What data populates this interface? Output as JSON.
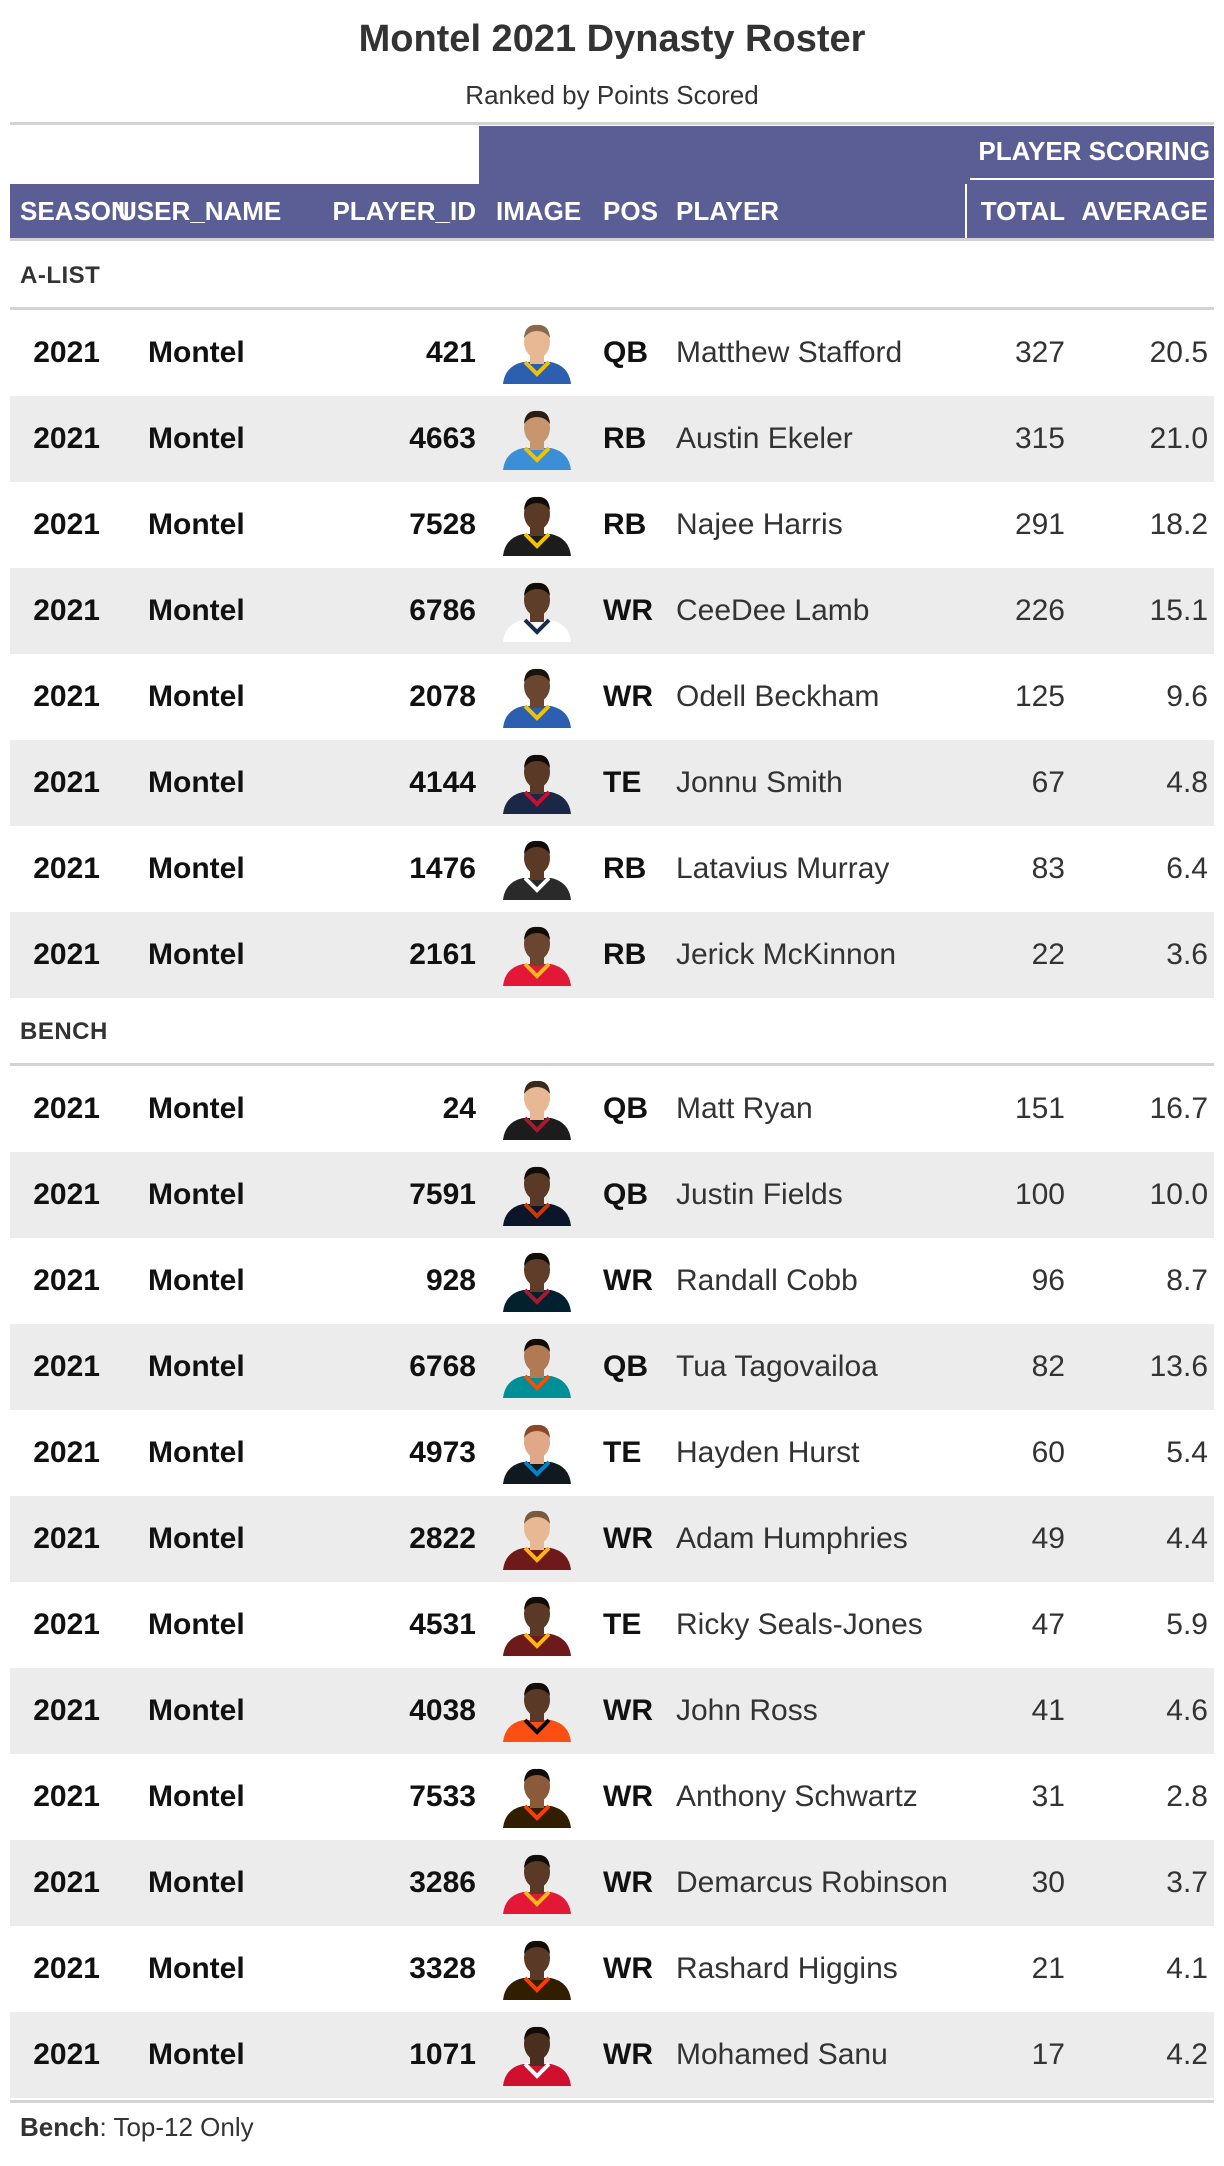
{
  "title": "Montel 2021 Dynasty Roster",
  "subtitle": "Ranked by Points Scored",
  "spanner": "PLAYER SCORING",
  "columns": {
    "season": "SEASON",
    "user_name": "USER_NAME",
    "player_id": "PLAYER_ID",
    "image": "IMAGE",
    "pos": "POS",
    "player": "PLAYER",
    "total": "TOTAL",
    "average": "AVERAGE"
  },
  "colors": {
    "header": "#5b5e94",
    "stripe": "#ececec",
    "rule": "#d3d3d3"
  },
  "groups": [
    {
      "label": "A-LIST",
      "rows": [
        {
          "season": "2021",
          "user_name": "Montel",
          "player_id": "421",
          "pos": "QB",
          "player": "Matthew Stafford",
          "total": "327",
          "average": "20.5",
          "jersey": "#2d5fb0",
          "trim": "#f2c200",
          "skin": "#e8b894",
          "hair": "#8a6a4a"
        },
        {
          "season": "2021",
          "user_name": "Montel",
          "player_id": "4663",
          "pos": "RB",
          "player": "Austin Ekeler",
          "total": "315",
          "average": "21.0",
          "jersey": "#3b8fd6",
          "trim": "#f2c200",
          "skin": "#c8966c",
          "hair": "#2a1d14"
        },
        {
          "season": "2021",
          "user_name": "Montel",
          "player_id": "7528",
          "pos": "RB",
          "player": "Najee Harris",
          "total": "291",
          "average": "18.2",
          "jersey": "#1c1c1c",
          "trim": "#f2c200",
          "skin": "#5a3a26",
          "hair": "#120c08"
        },
        {
          "season": "2021",
          "user_name": "Montel",
          "player_id": "6786",
          "pos": "WR",
          "player": "CeeDee Lamb",
          "total": "226",
          "average": "15.1",
          "jersey": "#ffffff",
          "trim": "#1a2a50",
          "skin": "#5f3d28",
          "hair": "#120c08"
        },
        {
          "season": "2021",
          "user_name": "Montel",
          "player_id": "2078",
          "pos": "WR",
          "player": "Odell Beckham",
          "total": "125",
          "average": "9.6",
          "jersey": "#2d5fb0",
          "trim": "#f2c200",
          "skin": "#6a4530",
          "hair": "#1a120c"
        },
        {
          "season": "2021",
          "user_name": "Montel",
          "player_id": "4144",
          "pos": "TE",
          "player": "Jonnu Smith",
          "total": "67",
          "average": "4.8",
          "jersey": "#1a2747",
          "trim": "#c8102e",
          "skin": "#5a3a26",
          "hair": "#120c08"
        },
        {
          "season": "2021",
          "user_name": "Montel",
          "player_id": "1476",
          "pos": "RB",
          "player": "Latavius Murray",
          "total": "83",
          "average": "6.4",
          "jersey": "#2a2a2a",
          "trim": "#ffffff",
          "skin": "#5a3a26",
          "hair": "#120c08"
        },
        {
          "season": "2021",
          "user_name": "Montel",
          "player_id": "2161",
          "pos": "RB",
          "player": "Jerick McKinnon",
          "total": "22",
          "average": "3.6",
          "jersey": "#e31837",
          "trim": "#ffb81c",
          "skin": "#6a4530",
          "hair": "#120c08"
        }
      ]
    },
    {
      "label": "BENCH",
      "rows": [
        {
          "season": "2021",
          "user_name": "Montel",
          "player_id": "24",
          "pos": "QB",
          "player": "Matt Ryan",
          "total": "151",
          "average": "16.7",
          "jersey": "#1c1c1c",
          "trim": "#a71930",
          "skin": "#e8b894",
          "hair": "#3a2a1a"
        },
        {
          "season": "2021",
          "user_name": "Montel",
          "player_id": "7591",
          "pos": "QB",
          "player": "Justin Fields",
          "total": "100",
          "average": "10.0",
          "jersey": "#0b162a",
          "trim": "#c83803",
          "skin": "#5a3a26",
          "hair": "#120c08"
        },
        {
          "season": "2021",
          "user_name": "Montel",
          "player_id": "928",
          "pos": "WR",
          "player": "Randall Cobb",
          "total": "96",
          "average": "8.7",
          "jersey": "#03202f",
          "trim": "#a71930",
          "skin": "#5f3d28",
          "hair": "#120c08"
        },
        {
          "season": "2021",
          "user_name": "Montel",
          "player_id": "6768",
          "pos": "QB",
          "player": "Tua Tagovailoa",
          "total": "82",
          "average": "13.6",
          "jersey": "#008e97",
          "trim": "#fc4c02",
          "skin": "#b07a52",
          "hair": "#120c08"
        },
        {
          "season": "2021",
          "user_name": "Montel",
          "player_id": "4973",
          "pos": "TE",
          "player": "Hayden Hurst",
          "total": "60",
          "average": "5.4",
          "jersey": "#101820",
          "trim": "#0085ca",
          "skin": "#e0a888",
          "hair": "#8a4a2a"
        },
        {
          "season": "2021",
          "user_name": "Montel",
          "player_id": "2822",
          "pos": "WR",
          "player": "Adam Humphries",
          "total": "49",
          "average": "4.4",
          "jersey": "#6e1a1a",
          "trim": "#ffb612",
          "skin": "#e8b894",
          "hair": "#7a5a3a"
        },
        {
          "season": "2021",
          "user_name": "Montel",
          "player_id": "4531",
          "pos": "TE",
          "player": "Ricky Seals-Jones",
          "total": "47",
          "average": "5.9",
          "jersey": "#6e1a1a",
          "trim": "#ffb612",
          "skin": "#5a3a26",
          "hair": "#120c08"
        },
        {
          "season": "2021",
          "user_name": "Montel",
          "player_id": "4038",
          "pos": "WR",
          "player": "John Ross",
          "total": "41",
          "average": "4.6",
          "jersey": "#fb4f14",
          "trim": "#000000",
          "skin": "#5a3a26",
          "hair": "#120c08"
        },
        {
          "season": "2021",
          "user_name": "Montel",
          "player_id": "7533",
          "pos": "WR",
          "player": "Anthony Schwartz",
          "total": "31",
          "average": "2.8",
          "jersey": "#311d00",
          "trim": "#ff3c00",
          "skin": "#8a5a3a",
          "hair": "#120c08"
        },
        {
          "season": "2021",
          "user_name": "Montel",
          "player_id": "3286",
          "pos": "WR",
          "player": "Demarcus Robinson",
          "total": "30",
          "average": "3.7",
          "jersey": "#e31837",
          "trim": "#ffb81c",
          "skin": "#5a3a26",
          "hair": "#120c08"
        },
        {
          "season": "2021",
          "user_name": "Montel",
          "player_id": "3328",
          "pos": "WR",
          "player": "Rashard Higgins",
          "total": "21",
          "average": "4.1",
          "jersey": "#311d00",
          "trim": "#ff3c00",
          "skin": "#5a3a26",
          "hair": "#120c08"
        },
        {
          "season": "2021",
          "user_name": "Montel",
          "player_id": "1071",
          "pos": "WR",
          "player": "Mohamed Sanu",
          "total": "17",
          "average": "4.2",
          "jersey": "#d0102e",
          "trim": "#ffffff",
          "skin": "#4a2e1e",
          "hair": "#120c08"
        }
      ]
    }
  ],
  "footnote": {
    "label": "Bench",
    "text": ": Top-12 Only"
  }
}
